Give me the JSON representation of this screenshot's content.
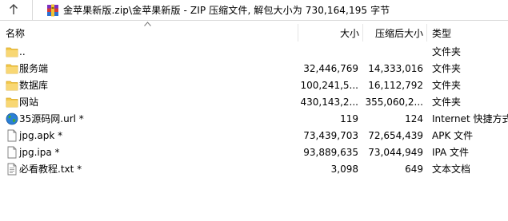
{
  "pathbar": {
    "path": "金苹果新版.zip\\金苹果新版 - ZIP 压缩文件, 解包大小为 730,164,195 字节"
  },
  "columns": {
    "name": "名称",
    "size": "大小",
    "packed": "压缩后大小",
    "type": "类型"
  },
  "rows": [
    {
      "icon": "folder-up-icon",
      "name": "..",
      "size": "",
      "packed": "",
      "type": "文件夹"
    },
    {
      "icon": "folder-icon",
      "name": "服务端",
      "size": "32,446,769",
      "packed": "14,333,016",
      "type": "文件夹"
    },
    {
      "icon": "folder-icon",
      "name": "数据库",
      "size": "100,241,5...",
      "packed": "16,112,792",
      "type": "文件夹"
    },
    {
      "icon": "folder-icon",
      "name": "网站",
      "size": "430,143,2...",
      "packed": "355,060,2...",
      "type": "文件夹"
    },
    {
      "icon": "globe-icon",
      "name": "35源码网.url *",
      "size": "119",
      "packed": "124",
      "type": "Internet 快捷方式"
    },
    {
      "icon": "document-icon",
      "name": "jpg.apk *",
      "size": "73,439,703",
      "packed": "72,654,439",
      "type": "APK 文件"
    },
    {
      "icon": "document-icon",
      "name": "jpg.ipa *",
      "size": "93,889,635",
      "packed": "73,044,949",
      "type": "IPA 文件"
    },
    {
      "icon": "text-document-icon",
      "name": "必看教程.txt *",
      "size": "3,098",
      "packed": "649",
      "type": "文本文档"
    }
  ]
}
